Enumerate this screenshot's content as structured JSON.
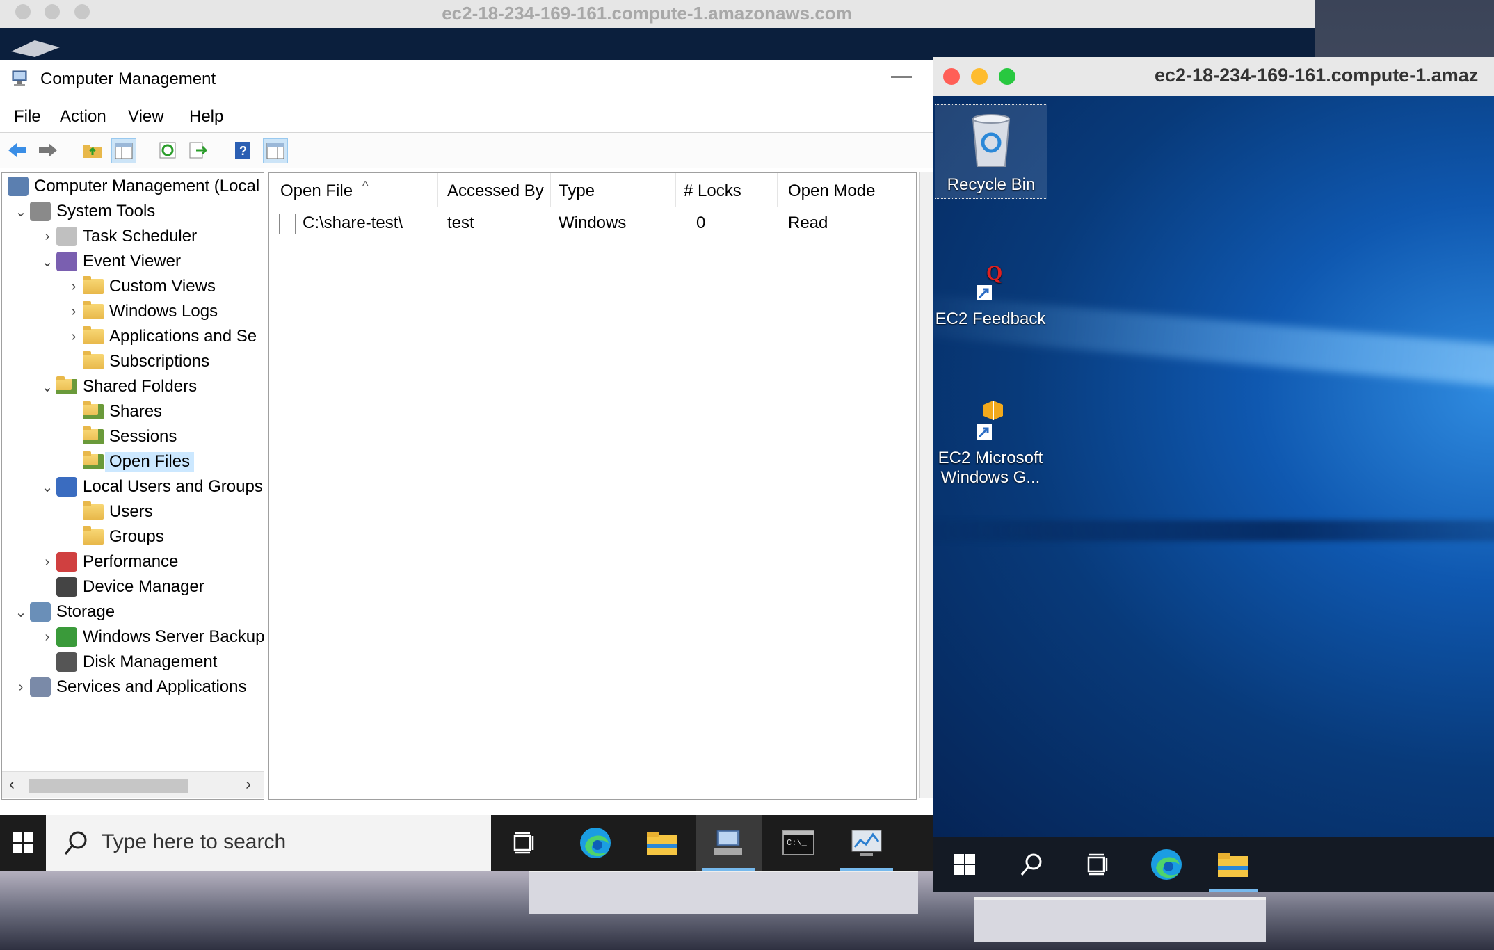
{
  "host": {
    "window_title": "ec2-18-234-169-161.compute-1.amazonaws.com"
  },
  "computer_management": {
    "title": "Computer Management",
    "minimize_glyph": "—",
    "menu": [
      "File",
      "Action",
      "View",
      "Help"
    ],
    "toolbar_icons": [
      "back-arrow-icon",
      "forward-arrow-icon",
      "up-folder-icon",
      "show-hide-tree-icon",
      "refresh-icon",
      "export-list-icon",
      "help-icon",
      "properties-pane-icon"
    ],
    "tree": [
      {
        "label": "Computer Management (Local",
        "level": 0,
        "chevron": "",
        "icon": "computer-management-icon"
      },
      {
        "label": "System Tools",
        "level": 1,
        "chevron": "v",
        "icon": "tools-icon"
      },
      {
        "label": "Task Scheduler",
        "level": 2,
        "chevron": ">",
        "icon": "clock-icon"
      },
      {
        "label": "Event Viewer",
        "level": 2,
        "chevron": "v",
        "icon": "event-viewer-icon"
      },
      {
        "label": "Custom Views",
        "level": 3,
        "chevron": ">",
        "icon": "folder-filter-icon"
      },
      {
        "label": "Windows Logs",
        "level": 3,
        "chevron": ">",
        "icon": "folder-log-icon"
      },
      {
        "label": "Applications and Se",
        "level": 3,
        "chevron": ">",
        "icon": "folder-app-icon"
      },
      {
        "label": "Subscriptions",
        "level": 3,
        "chevron": "",
        "icon": "folder-sub-icon"
      },
      {
        "label": "Shared Folders",
        "level": 2,
        "chevron": "v",
        "icon": "shared-folder-icon"
      },
      {
        "label": "Shares",
        "level": 3,
        "chevron": "",
        "icon": "shared-folder-icon"
      },
      {
        "label": "Sessions",
        "level": 3,
        "chevron": "",
        "icon": "shared-folder-icon"
      },
      {
        "label": "Open Files",
        "level": 3,
        "chevron": "",
        "icon": "shared-folder-icon",
        "selected": true
      },
      {
        "label": "Local Users and Groups",
        "level": 2,
        "chevron": "v",
        "icon": "users-icon"
      },
      {
        "label": "Users",
        "level": 3,
        "chevron": "",
        "icon": "folder-icon"
      },
      {
        "label": "Groups",
        "level": 3,
        "chevron": "",
        "icon": "folder-icon"
      },
      {
        "label": "Performance",
        "level": 2,
        "chevron": ">",
        "icon": "performance-icon"
      },
      {
        "label": "Device Manager",
        "level": 2,
        "chevron": "",
        "icon": "device-manager-icon"
      },
      {
        "label": "Storage",
        "level": 1,
        "chevron": "v",
        "icon": "storage-icon"
      },
      {
        "label": "Windows Server Backup",
        "level": 2,
        "chevron": ">",
        "icon": "backup-icon"
      },
      {
        "label": "Disk Management",
        "level": 2,
        "chevron": "",
        "icon": "disk-icon"
      },
      {
        "label": "Services and Applications",
        "level": 1,
        "chevron": ">",
        "icon": "services-icon"
      }
    ],
    "list": {
      "columns": [
        "Open File",
        "Accessed By",
        "Type",
        "# Locks",
        "Open Mode"
      ],
      "rows": [
        {
          "open_file": "C:\\share-test\\",
          "accessed_by": "test",
          "type": "Windows",
          "locks": "0",
          "open_mode": "Read"
        }
      ]
    }
  },
  "host_taskbar": {
    "search_placeholder": "Type here to search",
    "icons": [
      "task-view-icon",
      "edge-icon",
      "file-explorer-icon",
      "computer-management-icon",
      "command-prompt-icon",
      "server-manager-icon"
    ]
  },
  "front_window": {
    "title": "ec2-18-234-169-161.compute-1.amaz",
    "desktop_icons": [
      {
        "label": "Recycle Bin",
        "icon": "recycle-bin-icon"
      },
      {
        "label": "EC2 Feedback",
        "icon": "ec2-feedback-icon"
      },
      {
        "label_line1": "EC2 Microsoft",
        "label_line2": "Windows G...",
        "icon": "ec2-windows-guide-icon"
      }
    ],
    "taskbar_icons": [
      "start-icon",
      "search-icon",
      "task-view-icon",
      "edge-icon",
      "file-explorer-icon"
    ]
  }
}
